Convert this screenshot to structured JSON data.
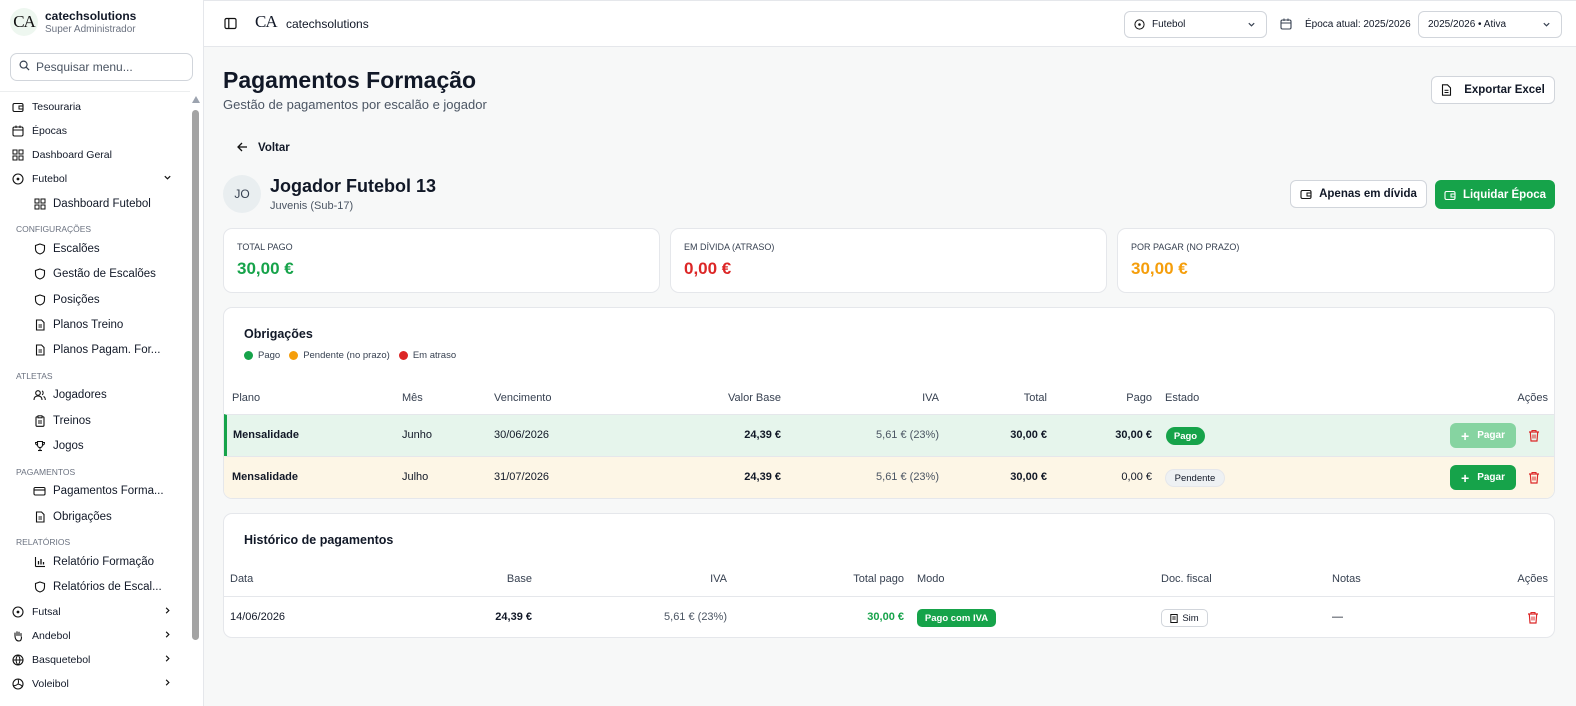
{
  "sidebar": {
    "brand_logo": "CA",
    "brand_name": "catechsolutions",
    "brand_role": "Super Administrador",
    "search_placeholder": "Pesquisar menu...",
    "items": {
      "tesouraria": "Tesouraria",
      "epocas": "Épocas",
      "dashboard_geral": "Dashboard Geral",
      "futebol": "Futebol",
      "dashboard_futebol": "Dashboard Futebol",
      "sec_config": "CONFIGURAÇÕES",
      "escaloes": "Escalões",
      "gestao_escaloes": "Gestão de Escalões",
      "posicoes": "Posições",
      "planos_treino": "Planos Treino",
      "planos_pagam": "Planos Pagam. For...",
      "sec_atletas": "ATLETAS",
      "jogadores": "Jogadores",
      "treinos": "Treinos",
      "jogos": "Jogos",
      "sec_pagamentos": "PAGAMENTOS",
      "pagamentos_formacao": "Pagamentos Forma...",
      "obrigacoes": "Obrigações",
      "sec_relatorios": "RELATÓRIOS",
      "relatorio_formacao": "Relatório Formação",
      "relatorios_escaloes": "Relatórios de Escal...",
      "futsal": "Futsal",
      "andebol": "Andebol",
      "basquetebol": "Basquetebol",
      "voleibol": "Voleibol"
    }
  },
  "header": {
    "logo": "CA",
    "org_name": "catechsolutions",
    "sport": "Futebol",
    "season_label": "Época atual: 2025/2026",
    "season_select": "2025/2026 • Ativa"
  },
  "page": {
    "title": "Pagamentos Formação",
    "subtitle": "Gestão de pagamentos por escalão e jogador",
    "export_label": "Exportar Excel",
    "back_label": "Voltar"
  },
  "player": {
    "initials": "JO",
    "name": "Jogador Futebol 13",
    "team": "Juvenis (Sub-17)",
    "debt_filter_label": "Apenas em dívida",
    "settle_label": "Liquidar Época"
  },
  "stats": {
    "total_pago_label": "TOTAL PAGO",
    "total_pago": "30,00 €",
    "em_divida_label": "EM DÍVIDA (ATRASO)",
    "em_divida": "0,00 €",
    "por_pagar_label": "POR PAGAR (NO PRAZO)",
    "por_pagar": "30,00 €"
  },
  "colors": {
    "green": "#16a34a",
    "red": "#dc2626",
    "orange": "#f59e0b",
    "paid_row": "#e6f5ec",
    "pending_row": "#fdf6e6"
  },
  "obligations": {
    "title": "Obrigações",
    "legend": [
      "Pago",
      "Pendente (no prazo)",
      "Em atraso"
    ],
    "headers": {
      "plano": "Plano",
      "mes": "Mês",
      "vencimento": "Vencimento",
      "valor_base": "Valor Base",
      "iva": "IVA",
      "total": "Total",
      "pago": "Pago",
      "estado": "Estado",
      "acoes": "Ações"
    },
    "rows": [
      {
        "plano": "Mensalidade",
        "mes": "Junho",
        "vencimento": "30/06/2026",
        "valor_base": "24,39 €",
        "iva": "5,61 € (23%)",
        "total": "30,00 €",
        "pago": "30,00 €",
        "estado": "Pago",
        "action": "Pagar"
      },
      {
        "plano": "Mensalidade",
        "mes": "Julho",
        "vencimento": "31/07/2026",
        "valor_base": "24,39 €",
        "iva": "5,61 € (23%)",
        "total": "30,00 €",
        "pago": "0,00 €",
        "estado": "Pendente",
        "action": "Pagar"
      }
    ]
  },
  "history": {
    "title": "Histórico de pagamentos",
    "headers": {
      "data": "Data",
      "base": "Base",
      "iva": "IVA",
      "total_pago": "Total pago",
      "modo": "Modo",
      "doc_fiscal": "Doc. fiscal",
      "notas": "Notas",
      "acoes": "Ações"
    },
    "rows": [
      {
        "data": "14/06/2026",
        "base": "24,39 €",
        "iva": "5,61 € (23%)",
        "total_pago": "30,00 €",
        "modo": "Pago com IVA",
        "doc_fiscal": "Sim",
        "notas": "—"
      }
    ]
  }
}
